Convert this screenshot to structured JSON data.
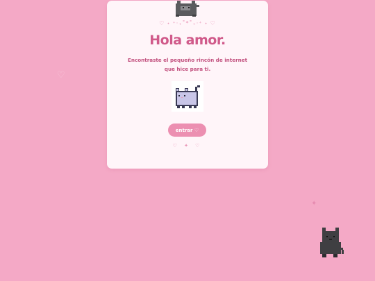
{
  "card": {
    "sparkle_row": "♡  ˖ ⁺‧₊˚*˚₊‧⁺ ˖  ♡",
    "title": "Hola amor.",
    "subtitle": "Encontraste el pequeño rincón de internet que hice para ti.",
    "enter_button": "entrar ♡",
    "bottom_decoration": "♡ ✦ ♡"
  },
  "decorations": {
    "background_heart": "♡",
    "background_sparkle": "✦"
  },
  "icons": [
    "grey-cat-icon",
    "pixel-cat-icon",
    "black-cat-icon",
    "heart-icon",
    "sparkle-icon"
  ],
  "colors": {
    "background": "#f4a9c6",
    "card": "#fff5f9",
    "title": "#d05a8a",
    "button": "#ec8fb1"
  }
}
